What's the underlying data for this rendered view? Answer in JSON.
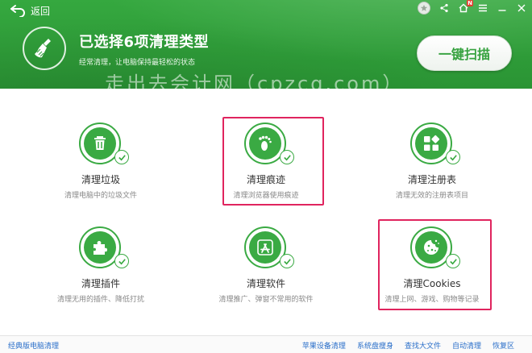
{
  "header": {
    "back_label": "返回",
    "title": "已选择6项清理类型",
    "subtitle": "经常清理，让电脑保持最轻松的状态",
    "watermark": "走出去会计网（cpzcq.com）",
    "scan_button": "一键扫描",
    "notify_badge": "N"
  },
  "cards": [
    {
      "label": "清理垃圾",
      "desc": "清理电脑中的垃圾文件",
      "icon": "trash-icon"
    },
    {
      "label": "清理痕迹",
      "desc": "清理浏览器使用痕迹",
      "icon": "footprint-icon"
    },
    {
      "label": "清理注册表",
      "desc": "清理无效的注册表项目",
      "icon": "registry-icon"
    },
    {
      "label": "清理插件",
      "desc": "清理无用的插件、降低打扰",
      "icon": "puzzle-icon"
    },
    {
      "label": "清理软件",
      "desc": "清理推广、弹窗不常用的软件",
      "icon": "app-store-icon"
    },
    {
      "label": "清理Cookies",
      "desc": "清理上网、游戏、购物等记录",
      "icon": "cookie-icon"
    }
  ],
  "footer": {
    "left_link": "经典版电脑清理",
    "links": [
      "苹果设备清理",
      "系统盘瘦身",
      "查找大文件",
      "自动清理",
      "恢复区"
    ]
  },
  "colors": {
    "header_green": "#2f9d39",
    "accent_green": "#3aaa43",
    "highlight": "#e0245e",
    "link_blue": "#2a6fc9"
  }
}
